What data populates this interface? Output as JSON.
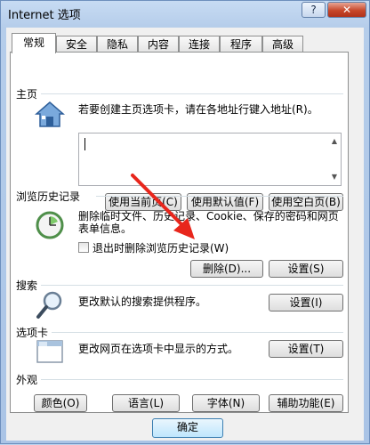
{
  "window": {
    "title": "Internet 选项",
    "help_label": "?",
    "close_label": "✕"
  },
  "tabs": [
    {
      "label": "常规",
      "active": true
    },
    {
      "label": "安全",
      "active": false
    },
    {
      "label": "隐私",
      "active": false
    },
    {
      "label": "内容",
      "active": false
    },
    {
      "label": "连接",
      "active": false
    },
    {
      "label": "程序",
      "active": false
    },
    {
      "label": "高级",
      "active": false
    }
  ],
  "homepage": {
    "title": "主页",
    "description": "若要创建主页选项卡，请在各地址行键入地址(R)。",
    "address_value": "",
    "buttons": {
      "use_current": "使用当前页(C)",
      "use_default": "使用默认值(F)",
      "use_blank": "使用空白页(B)"
    }
  },
  "history": {
    "title": "浏览历史记录",
    "description_line1": "删除临时文件、历史记录、Cookie、保存的密码和网页",
    "description_line2": "表单信息。",
    "checkbox_label": "退出时删除浏览历史记录(W)",
    "checkbox_checked": false,
    "buttons": {
      "delete": "删除(D)...",
      "settings": "设置(S)"
    }
  },
  "search": {
    "title": "搜索",
    "description": "更改默认的搜索提供程序。",
    "settings_label": "设置(I)"
  },
  "tabs_section": {
    "title": "选项卡",
    "description": "更改网页在选项卡中显示的方式。",
    "settings_label": "设置(T)"
  },
  "appearance": {
    "title": "外观",
    "buttons": {
      "colors": "颜色(O)",
      "languages": "语言(L)",
      "fonts": "字体(N)",
      "accessibility": "辅助功能(E)"
    }
  },
  "footer": {
    "ok_label": "确定"
  },
  "colors": {
    "annotation_arrow": "#e8261c",
    "title_bar": "#bcd3ee"
  }
}
